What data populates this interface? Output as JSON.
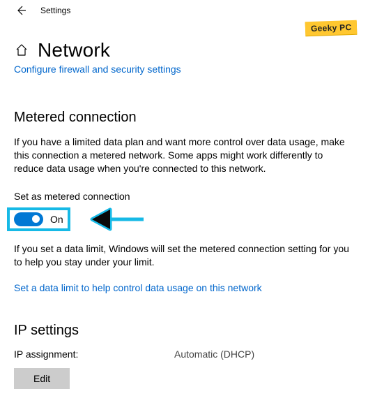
{
  "header": {
    "app_title": "Settings"
  },
  "watermark": "Geeky PC",
  "page": {
    "title": "Network",
    "configure_link": "Configure firewall and security settings"
  },
  "metered": {
    "heading": "Metered connection",
    "description": "If you have a limited data plan and want more control over data usage, make this connection a metered network. Some apps might work differently to reduce data usage when you're connected to this network.",
    "toggle_label": "Set as metered connection",
    "toggle_state": "On",
    "limit_hint": "If you set a data limit, Windows will set the metered connection setting for you to help you stay under your limit.",
    "data_limit_link": "Set a data limit to help control data usage on this network"
  },
  "ip": {
    "heading": "IP settings",
    "assignment_label": "IP assignment:",
    "assignment_value": "Automatic (DHCP)",
    "edit_label": "Edit"
  }
}
